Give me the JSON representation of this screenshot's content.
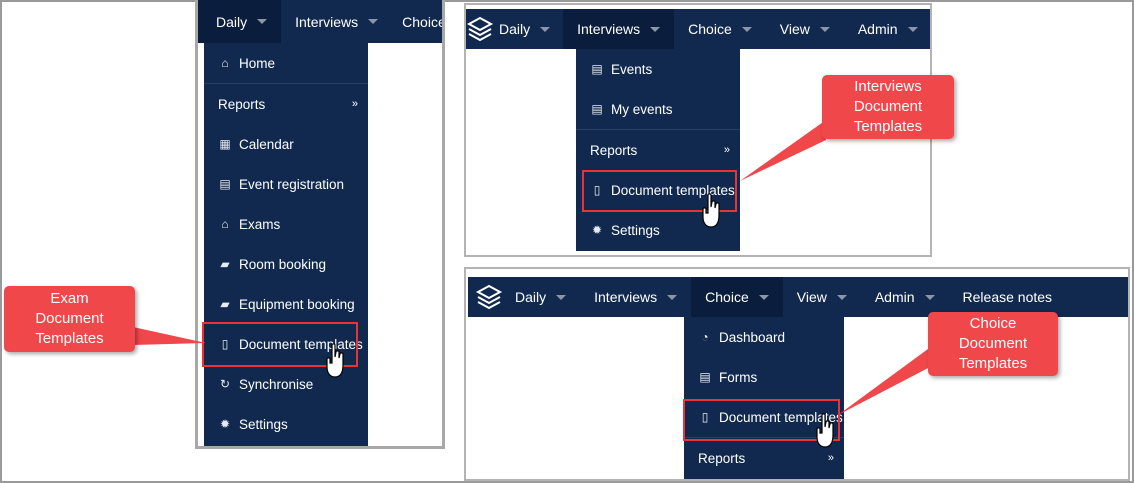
{
  "panel_exam": {
    "nav": [
      "Daily",
      "Interviews",
      "Choice"
    ],
    "menu": [
      {
        "icon": "home-icon",
        "label": "Home"
      },
      {
        "icon": "",
        "label": "Reports",
        "submenu": "»"
      },
      {
        "icon": "calendar-icon",
        "label": "Calendar"
      },
      {
        "icon": "list-icon",
        "label": "Event registration"
      },
      {
        "icon": "bank-icon",
        "label": "Exams"
      },
      {
        "icon": "book-icon",
        "label": "Room booking"
      },
      {
        "icon": "book-icon",
        "label": "Equipment booking"
      },
      {
        "icon": "file-icon",
        "label": "Document templates"
      },
      {
        "icon": "refresh-icon",
        "label": "Synchronise"
      },
      {
        "icon": "gear-icon",
        "label": "Settings"
      }
    ],
    "callout": "Exam\nDocument\nTemplates"
  },
  "panel_interviews": {
    "nav": [
      "Daily",
      "Interviews",
      "Choice",
      "View",
      "Admin"
    ],
    "menu": [
      {
        "icon": "list-icon",
        "label": "Events"
      },
      {
        "icon": "list-icon",
        "label": "My events"
      },
      {
        "icon": "",
        "label": "Reports",
        "submenu": "»"
      },
      {
        "icon": "file-icon",
        "label": "Document templates"
      },
      {
        "icon": "gear-icon",
        "label": "Settings"
      }
    ],
    "callout": "Interviews\nDocument\nTemplates"
  },
  "panel_choice": {
    "nav": [
      "Daily",
      "Interviews",
      "Choice",
      "View",
      "Admin",
      "Release notes"
    ],
    "menu": [
      {
        "icon": "dashboard-icon",
        "label": "Dashboard"
      },
      {
        "icon": "list-icon",
        "label": "Forms"
      },
      {
        "icon": "file-icon",
        "label": "Document templates"
      },
      {
        "icon": "",
        "label": "Reports",
        "submenu": "»"
      }
    ],
    "callout": "Choice\nDocument\nTemplates"
  },
  "colors": {
    "navbar": "#12294f",
    "highlight": "#e8333a",
    "callout": "#f0474b"
  }
}
